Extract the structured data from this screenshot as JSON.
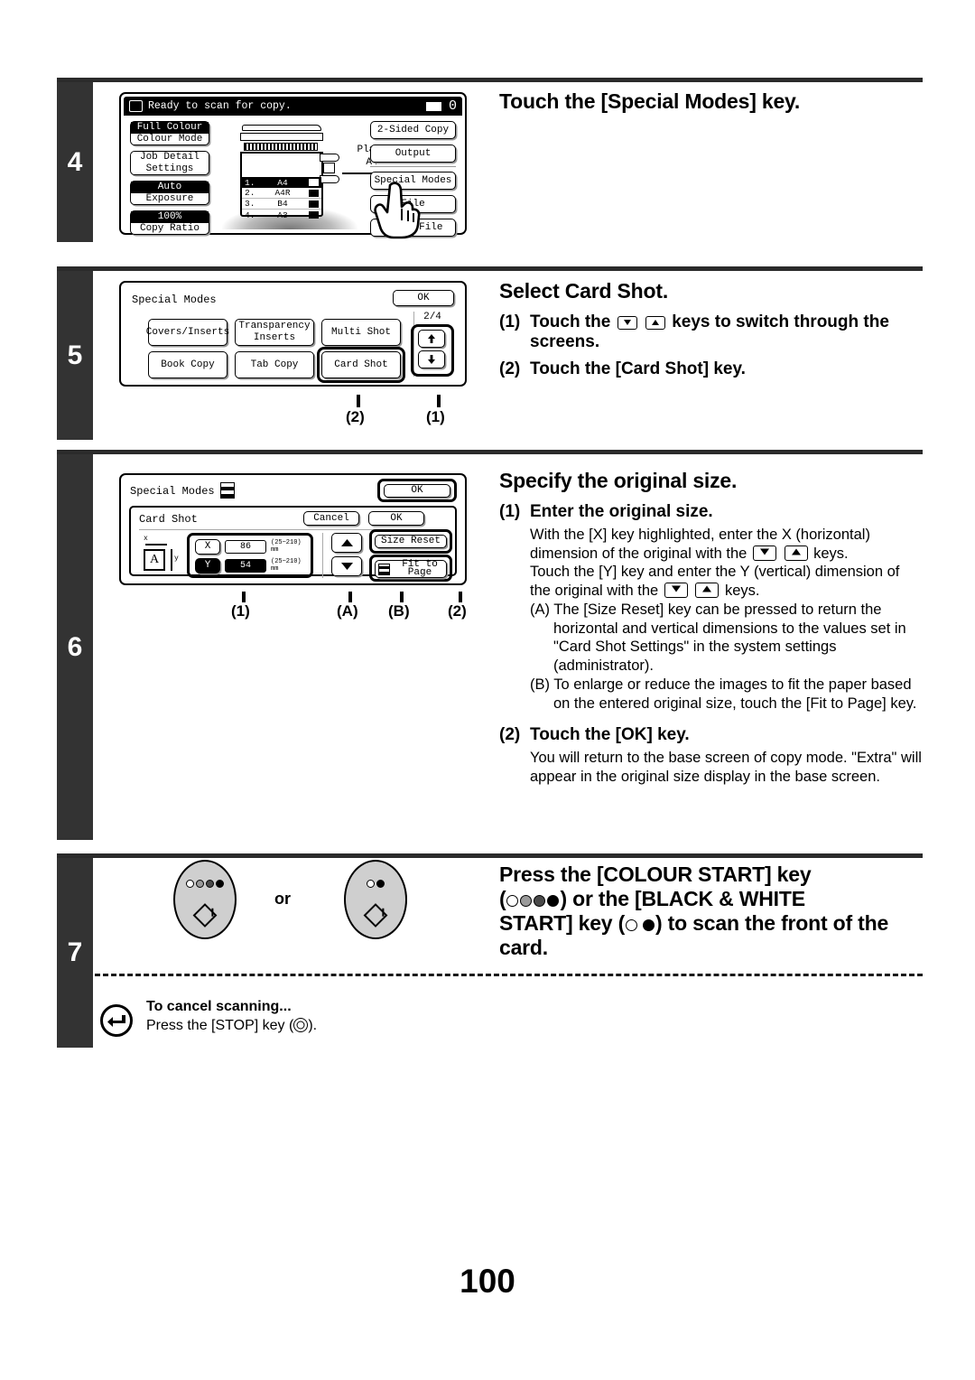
{
  "page": {
    "number": "100"
  },
  "steps": [
    {
      "number": "4",
      "title": "Touch the [Special Modes] key.",
      "panel": {
        "status_text": "Ready to scan for copy.",
        "counter": "0",
        "left_buttons": [
          {
            "top": "Full Colour",
            "bottom": "Colour Mode",
            "highlight": "top"
          },
          {
            "top": "Job Detail",
            "bottom": "Settings",
            "highlight": "none"
          },
          {
            "top": "Auto",
            "bottom": "Exposure",
            "highlight": "top"
          },
          {
            "top": "100%",
            "bottom": "Copy Ratio",
            "highlight": "top"
          }
        ],
        "right_buttons": [
          "2-Sided Copy",
          "Output",
          "Special Modes",
          "File",
          "Quick File"
        ],
        "paper_label_line1": "Plain",
        "paper_label_line2": "A4",
        "tray_list": [
          {
            "num": "1.",
            "size": "A4",
            "selected": true
          },
          {
            "num": "2.",
            "size": "A4R",
            "selected": false
          },
          {
            "num": "3.",
            "size": "B4",
            "selected": false
          },
          {
            "num": "4.",
            "size": "A3",
            "selected": false
          }
        ]
      }
    },
    {
      "number": "5",
      "title": "Select Card Shot.",
      "instructions": [
        {
          "mark": "(1)",
          "bold_before": "Touch the",
          "bold_after": "keys to switch through the screens."
        },
        {
          "mark": "(2)",
          "bold_before": "Touch the [Card Shot] key.",
          "bold_after": ""
        }
      ],
      "panel": {
        "header": "Special Modes",
        "ok_label": "OK",
        "page_indicator": "2/4",
        "buttons": [
          "Covers/Inserts",
          "Transparency Inserts",
          "Multi Shot",
          "Book Copy",
          "Tab Copy",
          "Card Shot"
        ],
        "selected_button": "Card Shot"
      },
      "callouts": [
        "(2)",
        "(1)"
      ]
    },
    {
      "number": "6",
      "title": "Specify the original size.",
      "sub1_mark": "(1)",
      "sub1_title": "Enter the original size.",
      "sub1_para1a": "With the [X] key highlighted, enter the X (horizontal)",
      "sub1_para1b": "dimension of the original with the",
      "sub1_para1c": "keys.",
      "sub1_para2a": "Touch the [Y] key and enter the Y (vertical) dimension of",
      "sub1_para2b": "the original with the",
      "sub1_para2c": "keys.",
      "sub1_itemA": "(A) The [Size Reset] key can be pressed to return the horizontal and vertical dimensions to the values set in \"Card Shot Settings\" in the system settings (administrator).",
      "sub1_itemB": "(B) To enlarge or reduce the images to fit the paper based on the entered original size, touch the [Fit to Page] key.",
      "sub2_mark": "(2)",
      "sub2_title": "Touch the [OK] key.",
      "sub2_para": "You will return to the base screen of copy mode. \"Extra\" will appear in the original size display in the base screen.",
      "panel": {
        "header": "Special Modes",
        "outer_ok": "OK",
        "section_title": "Card Shot",
        "cancel_label": "Cancel",
        "inner_ok": "OK",
        "x_key": "X",
        "x_value": "86",
        "x_range": "(25~210)",
        "x_unit": "mm",
        "y_key": "Y",
        "y_value": "54",
        "y_range": "(25~210)",
        "y_unit": "mm",
        "size_reset": "Size Reset",
        "fit_to_page_1": "Fit to",
        "fit_to_page_2": "Page",
        "thumb_letter": "A",
        "axis_x": "x",
        "axis_y": "y"
      },
      "callouts": [
        "(1)",
        "(A)",
        "(B)",
        "(2)"
      ]
    },
    {
      "number": "7",
      "title_line1": "Press the [COLOUR START] key",
      "title_line2_pre": "(",
      "title_line2_post": ") or the [BLACK & WHITE",
      "title_line3_pre": "START] key (",
      "title_line3_post": ") to scan the front of the",
      "title_line4": "card.",
      "or_label": "or",
      "note_title": "To cancel scanning...",
      "note_pre": "Press the [STOP] key (",
      "note_post": ")."
    }
  ]
}
